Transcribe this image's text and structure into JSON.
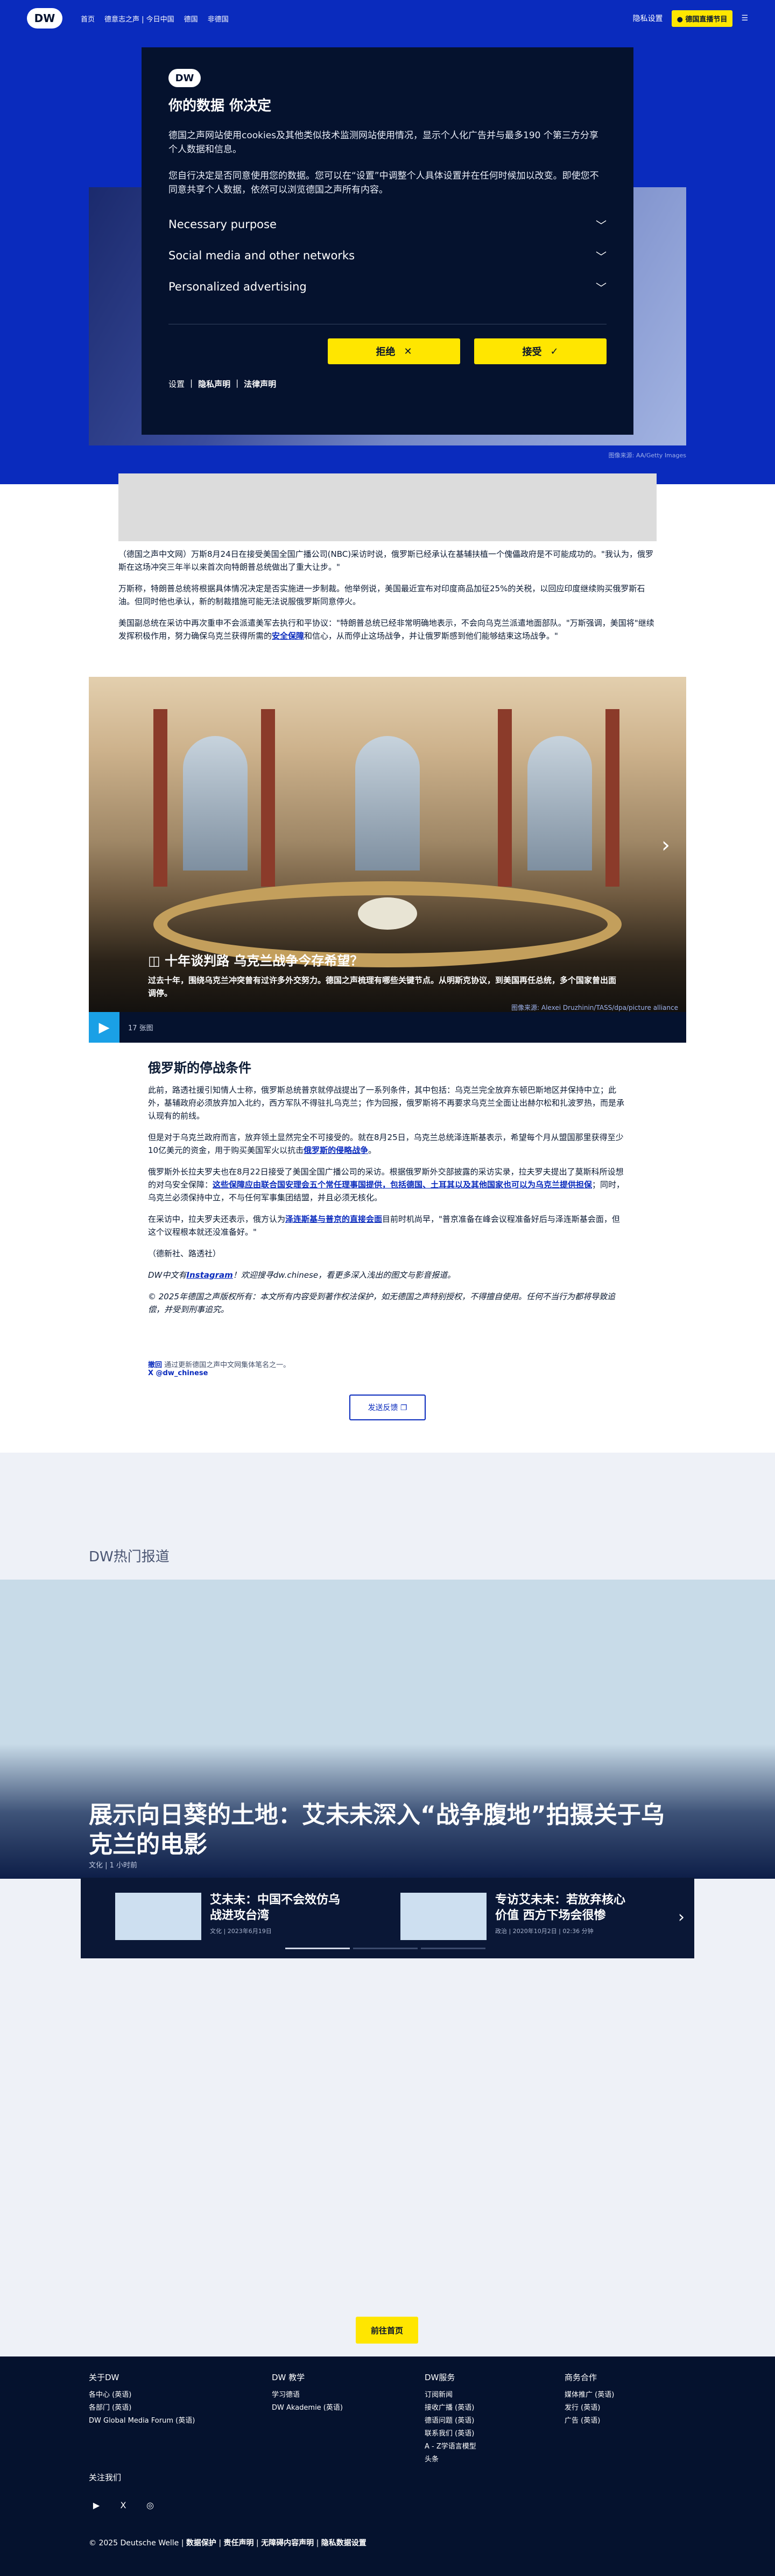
{
  "header": {
    "logo": "DW",
    "nav": [
      "首页",
      "德意志之声 | 今日中国",
      "德国",
      "非德国"
    ],
    "right_link": "隐私设置",
    "live_chip": "● 德国直播节目",
    "menu_icon": "menu-icon"
  },
  "hero": {
    "caption": "图像来源: AA/Getty Images"
  },
  "consent": {
    "logo": "DW",
    "title": "你的数据 你决定",
    "para1": "德国之声网站使用cookies及其他类似技术监测网站使用情况，显示个人化广告并与最多190 个第三方分享个人数据和信息。",
    "para2": "您自行决定是否同意使用您的数据。您可以在“设置”中调整个人具体设置并在任何时候加以改变。即使您不同意共享个人数据，依然可以浏览德国之声所有内容。",
    "options": [
      "Necessary purpose",
      "Social media and other networks",
      "Personalized advertising"
    ],
    "reject": "拒绝",
    "accept": "接受",
    "links": [
      "设置",
      "隐私声明",
      "法律声明"
    ]
  },
  "article": {
    "p1": "（德国之声中文网）万斯8月24日在接受美国全国广播公司(NBC)采访时说，俄罗斯已经承认在基辅扶植一个傀儡政府是不可能成功的。\"我认为，俄罗斯在这场冲突三年半以来首次向特朗普总统做出了重大让步。\"",
    "p2": "万斯称，特朗普总统将根据具体情况决定是否实施进一步制裁。他举例说，美国最近宣布对印度商品加征25%的关税，以回应印度继续购买俄罗斯石油。但同时他也承认，新的制裁措施可能无法说服俄罗斯同意停火。",
    "p3_pre": "美国副总统在采访中再次重申不会派遣美军去执行和平协议：\"特朗普总统已经非常明确地表示，不会向乌克兰派遣地面部队。\"万斯强调，美国将\"继续发挥积极作用，努力确保乌克兰获得所需的",
    "p3_link": "安全保障",
    "p3_post": "和信心，从而停止这场战争，并让俄罗斯感到他们能够结束这场战争。\""
  },
  "gallery": {
    "title": "十年谈判路 乌克兰战争今存希望？",
    "subtitle": "过去十年，围绕乌克兰冲突曾有过许多外交努力。德国之声梳理有哪些关键节点。从明斯克协议，到美国再任总统，多个国家曾出面调停。",
    "credit": "图像来源: Alexei Druzhinin/TASS/dpa/picture alliance",
    "count": "17 张图"
  },
  "section": {
    "title": "俄罗斯的停战条件",
    "p1": "此前，路透社援引知情人士称，俄罗斯总统普京就停战提出了一系列条件，其中包括：乌克兰完全放弃东顿巴斯地区并保持中立；此外，基辅政府必须放弃加入北约，西方军队不得驻扎乌克兰；作为回报，俄罗斯将不再要求乌克兰全面让出赫尔松和扎波罗热，而是承认现有的前线。",
    "p2_pre": "但是对于乌克兰政府而言，放弃领土显然完全不可接受的。就在8月25日，乌克兰总统泽连斯基表示，希望每个月从盟国那里获得至少10亿美元的资金，用于购买美国军火以抗击",
    "p2_link": "俄罗斯的侵略战争",
    "p2_post": "。",
    "p3_pre": "俄罗斯外长拉夫罗夫也在8月22日接受了美国全国广播公司的采访。根据俄罗斯外交部披露的采访实录，拉夫罗夫提出了莫斯科所设想的对乌安全保障：",
    "p3_link": "这些保障应由联合国安理会五个常任理事国提供，包括德国、土耳其以及其他国家也可以为乌克兰提供担保",
    "p3_post": "；同时，乌克兰必须保持中立，不与任何军事集团结盟，并且必须无核化。",
    "p4_pre": "在采访中，拉夫罗夫还表示，俄方认为",
    "p4_link": "泽连斯基与普京的直接会面",
    "p4_post": "目前时机尚早，\"普京准备在峰会议程准备好后与泽连斯基会面，但这个议程根本就还没准备好。\"",
    "p5": "（德新社、路透社）",
    "p6_pre": "DW中文有",
    "p6_link": "Instagram",
    "p6_post": "！欢迎搜寻dw.chinese，看更多深入浅出的图文与影音报道。",
    "p7": "© 2025年德国之声版权所有：本文所有内容受到著作权法保护，如无德国之声特别授权，不得擅自使用。任何不当行为都将导致追偿，并受到刑事追究。"
  },
  "correction": {
    "label": "撤回",
    "text": "通过更新德国之声中文网集体笔名之一。",
    "handle": "X @dw_chinese"
  },
  "feedback_button": "发送反馈 ❐",
  "hot": {
    "title": "DW热门报道",
    "feature_title": "展示向日葵的土地：艾未未深入“战争腹地”拍摄关于乌克兰的电影",
    "feature_meta": "文化 | 1 小时前",
    "cards": [
      {
        "title": "艾未未：中国不会效仿乌战进攻台湾",
        "meta": "文化 | 2023年6月19日"
      },
      {
        "title": "专访艾未未：若放弃核心价值 西方下场会很惨",
        "meta": "政治 | 2020年10月2日 | 02:36 分钟"
      }
    ]
  },
  "home_button": "前往首页",
  "footer": {
    "cols": [
      {
        "head": "关于DW",
        "items": [
          "各中心 (英语)",
          "各部门 (英语)",
          "DW Global Media Forum (英语)"
        ]
      },
      {
        "head": "DW 教学",
        "items": [
          "学习德语",
          "DW Akademie (英语)"
        ]
      },
      {
        "head": "DW服务",
        "items": [
          "订阅新闻",
          "接收广播 (英语)",
          "德语问题 (英语)",
          "联系我们 (英语)",
          "A - Z学语言模型",
          "头条"
        ]
      },
      {
        "head": "商务合作",
        "items": [
          "媒体推广 (英语)",
          "发行 (英语)",
          "广告 (英语)"
        ]
      }
    ],
    "follow": "关注我们",
    "socials": [
      "▶",
      "X",
      "◎"
    ],
    "copyright": "© 2025 Deutsche Welle",
    "links": [
      "数据保护",
      "责任声明",
      "无障碍内容声明",
      "隐私数据设置"
    ]
  }
}
